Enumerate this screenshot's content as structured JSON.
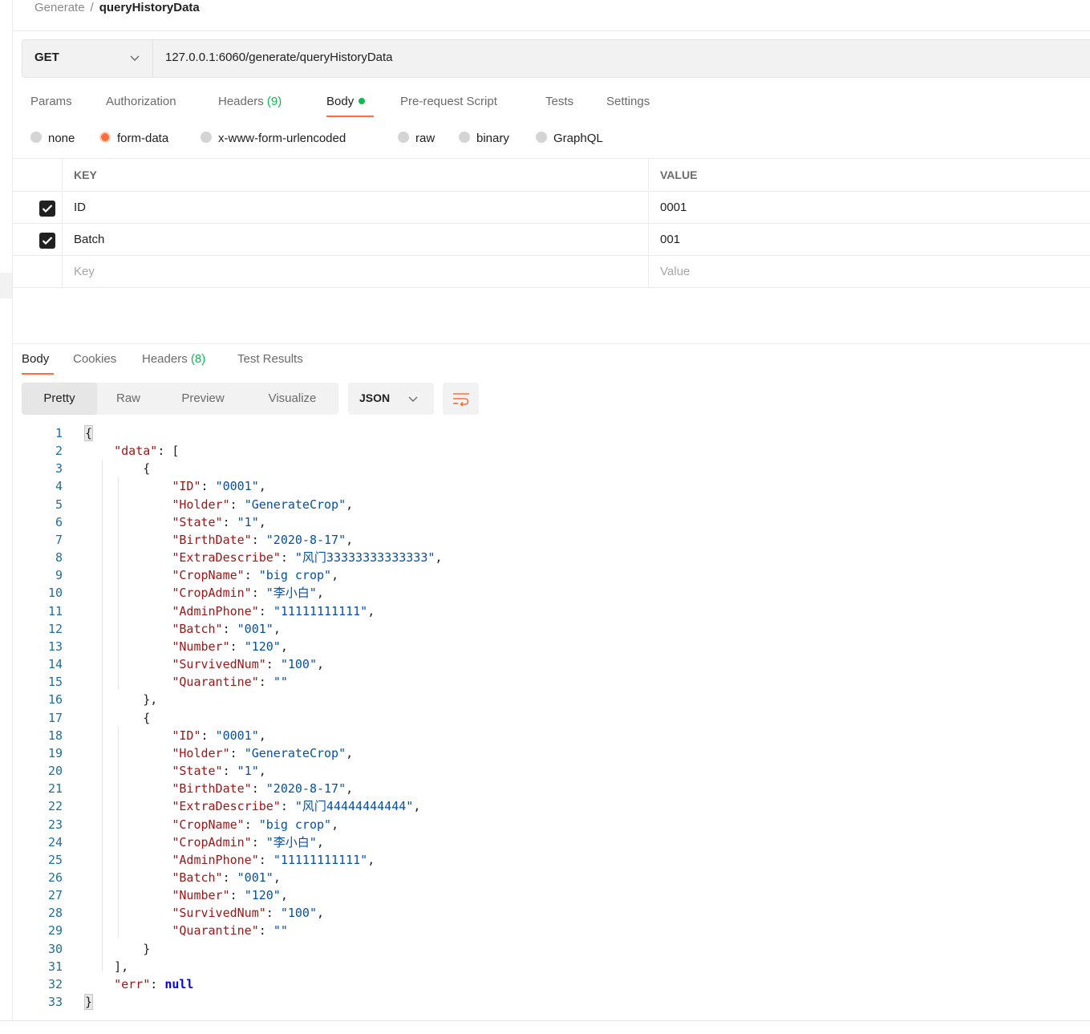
{
  "breadcrumb": {
    "parent": "Generate",
    "separator": "/",
    "current": "queryHistoryData"
  },
  "request": {
    "method": "GET",
    "url": "127.0.0.1:6060/generate/queryHistoryData"
  },
  "request_tabs": [
    {
      "label": "Params"
    },
    {
      "label": "Authorization"
    },
    {
      "label": "Headers",
      "count": "(9)"
    },
    {
      "label": "Body"
    },
    {
      "label": "Pre-request Script"
    },
    {
      "label": "Tests"
    },
    {
      "label": "Settings"
    }
  ],
  "body_types": [
    "none",
    "form-data",
    "x-www-form-urlencoded",
    "raw",
    "binary",
    "GraphQL"
  ],
  "body_type_selected": "form-data",
  "form_table": {
    "headers": {
      "key": "KEY",
      "value": "VALUE"
    },
    "rows": [
      {
        "checked": true,
        "key": "ID",
        "value": "0001"
      },
      {
        "checked": true,
        "key": "Batch",
        "value": "001"
      }
    ],
    "placeholder": {
      "key": "Key",
      "value": "Value"
    }
  },
  "response_tabs": [
    {
      "label": "Body"
    },
    {
      "label": "Cookies"
    },
    {
      "label": "Headers",
      "count": "(8)"
    },
    {
      "label": "Test Results"
    }
  ],
  "view_modes": [
    "Pretty",
    "Raw",
    "Preview",
    "Visualize"
  ],
  "view_selected": "Pretty",
  "format": "JSON",
  "response_lines": [
    "{",
    "    \"data\": [",
    "        {",
    "            \"ID\": \"0001\",",
    "            \"Holder\": \"GenerateCrop\",",
    "            \"State\": \"1\",",
    "            \"BirthDate\": \"2020-8-17\",",
    "            \"ExtraDescribe\": \"风门33333333333333\",",
    "            \"CropName\": \"big crop\",",
    "            \"CropAdmin\": \"李小白\",",
    "            \"AdminPhone\": \"11111111111\",",
    "            \"Batch\": \"001\",",
    "            \"Number\": \"120\",",
    "            \"SurvivedNum\": \"100\",",
    "            \"Quarantine\": \"\"",
    "        },",
    "        {",
    "            \"ID\": \"0001\",",
    "            \"Holder\": \"GenerateCrop\",",
    "            \"State\": \"1\",",
    "            \"BirthDate\": \"2020-8-17\",",
    "            \"ExtraDescribe\": \"风门44444444444\",",
    "            \"CropName\": \"big crop\",",
    "            \"CropAdmin\": \"李小白\",",
    "            \"AdminPhone\": \"11111111111\",",
    "            \"Batch\": \"001\",",
    "            \"Number\": \"120\",",
    "            \"SurvivedNum\": \"100\",",
    "            \"Quarantine\": \"\"",
    "        }",
    "    ],",
    "    \"err\": null",
    "}"
  ],
  "colors": {
    "accent": "#ff6c37",
    "success": "#0cbb52",
    "json_key": "#a31515",
    "json_string": "#0451a5",
    "json_keyword": "#0000ff",
    "line_number": "#1f6f9b"
  }
}
